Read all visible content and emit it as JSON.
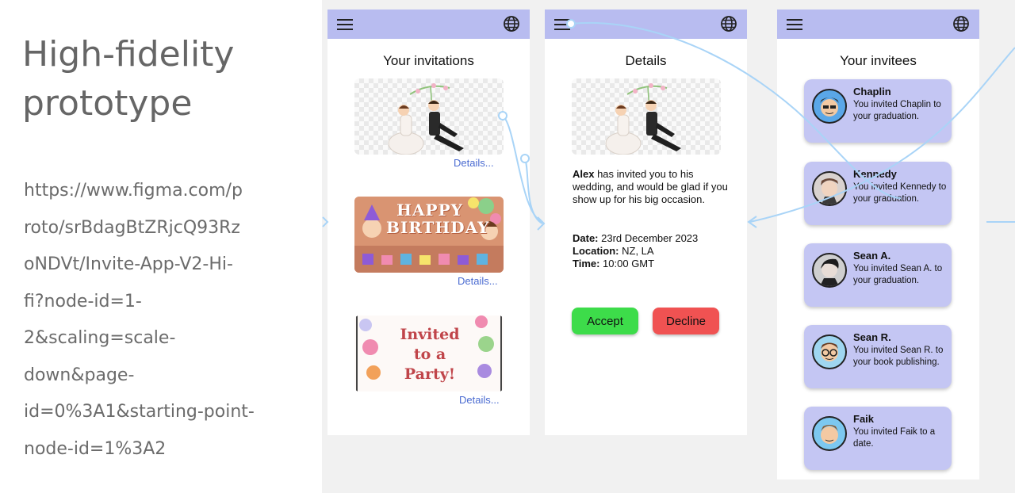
{
  "slide": {
    "title": "High-fidelity prototype",
    "title_lines": [
      "High-fidelity",
      "prototype"
    ],
    "url_lines": [
      "https://www.figma.com/p",
      "roto/srBdagBtZRjcQ93Rz",
      "oNDVt/Invite-App-V2-Hi-",
      "fi?node-id=1-",
      "2&scaling=scale-",
      "down&page-",
      "id=0%3A1&starting-point-",
      "node-id=1%3A2"
    ]
  },
  "icons": {
    "menu": "hamburger-menu-icon",
    "language": "globe-icon"
  },
  "colors": {
    "topbar": "#b8bcf0",
    "card": "#c4c6f3",
    "accept": "#3ddc4a",
    "decline": "#f05252",
    "link": "#4a6bd1",
    "connector": "#a9d4f7"
  },
  "screen1": {
    "title": "Your invitations",
    "details_label": "Details...",
    "cards": [
      {
        "image": "wedding-couple",
        "details": "Details..."
      },
      {
        "image": "happy-birthday",
        "text": "HAPPY BIRTHDAY",
        "details": "Details..."
      },
      {
        "image": "party-invite",
        "text_line1": "Invited",
        "text_line2": "to a Party!",
        "details": "Details..."
      }
    ]
  },
  "screen2": {
    "title": "Details",
    "image": "wedding-couple",
    "host": "Alex",
    "message": " has invited you to his wedding, and would be glad if you show up for his big occasion.",
    "date_label": "Date:",
    "date_value": " 23rd December 2023",
    "location_label": "Location:",
    "location_value": " NZ, LA",
    "time_label": "Time:",
    "time_value": " 10:00 GMT",
    "accept_label": "Accept",
    "decline_label": "Decline"
  },
  "screen3": {
    "title": "Your invitees",
    "invitees": [
      {
        "name": "Chaplin",
        "text": "You invited Chaplin to your graduation."
      },
      {
        "name": "Kennedy",
        "text": "You invited Kennedy to your graduation."
      },
      {
        "name": "Sean A.",
        "text": "You invited Sean A. to your graduation."
      },
      {
        "name": "Sean R.",
        "text": "You invited Sean R. to your book publishing."
      },
      {
        "name": "Faik",
        "text": "You invited Faik to a date."
      }
    ]
  }
}
